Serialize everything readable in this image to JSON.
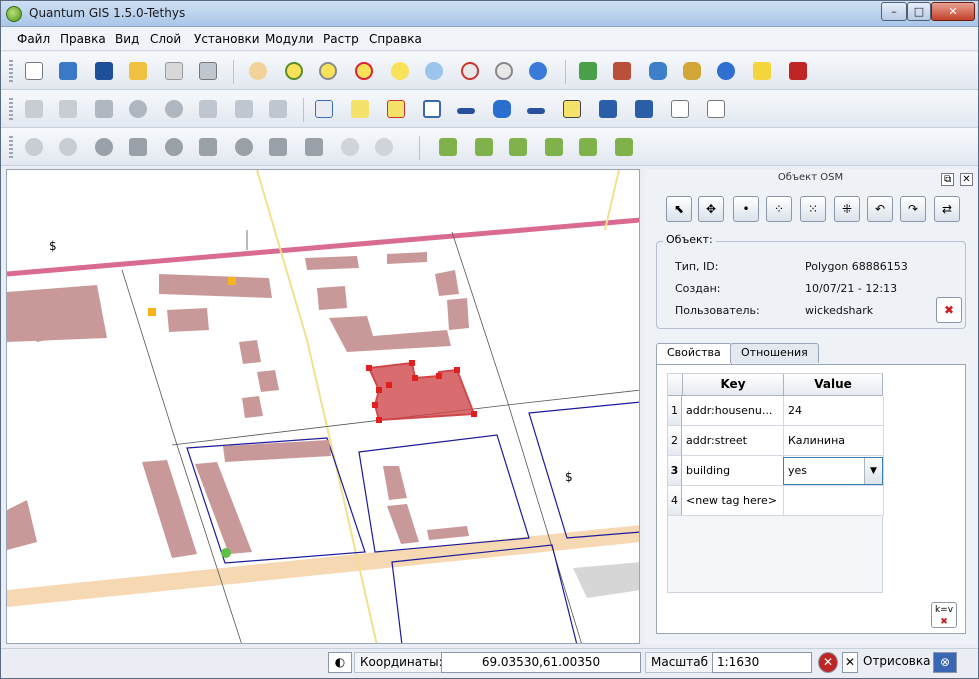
{
  "window": {
    "title": "Quantum GIS 1.5.0-Tethys",
    "min": "–",
    "max": "□",
    "close": "✕"
  },
  "menu": [
    "Файл",
    "Правка",
    "Вид",
    "Слой",
    "Установки",
    "Модули",
    "Растр",
    "Справка"
  ],
  "map": {
    "dollar_symbol": "$"
  },
  "osm_panel": {
    "title": "Объект OSM",
    "float_btn": "⧉",
    "close_btn": "✕",
    "object_group": {
      "title": "Объект:",
      "rows": [
        {
          "label": "Тип, ID:",
          "value": "Polygon  68886153"
        },
        {
          "label": "Создан:",
          "value": "10/07/21 - 12:13"
        },
        {
          "label": "Пользователь:",
          "value": "wickedshark"
        }
      ]
    },
    "tabs": [
      "Свойства",
      "Отношения"
    ],
    "table": {
      "headers": [
        "Key",
        "Value"
      ],
      "rows": [
        {
          "n": "1",
          "key": "addr:housenu...",
          "value": "24"
        },
        {
          "n": "2",
          "key": "addr:street",
          "value": "Калинина"
        },
        {
          "n": "3",
          "key": "building",
          "value": "yes"
        },
        {
          "n": "4",
          "key": "<new tag here>",
          "value": ""
        }
      ]
    },
    "kv_button": "k=v"
  },
  "statusbar": {
    "coords_label": "Координаты:",
    "coords_value": "69.03530,61.00350",
    "scale_label": "Масштаб",
    "scale_value": "1:1630",
    "render_label": "Отрисовка"
  },
  "colors": {
    "selected_polygon": "#d0474b",
    "building": "#c9999a",
    "road_pink": "#d96b92",
    "road_yellow": "#f2e08c",
    "road_beige": "#f6d8b2",
    "boundary_blue": "#1a1a9c"
  }
}
